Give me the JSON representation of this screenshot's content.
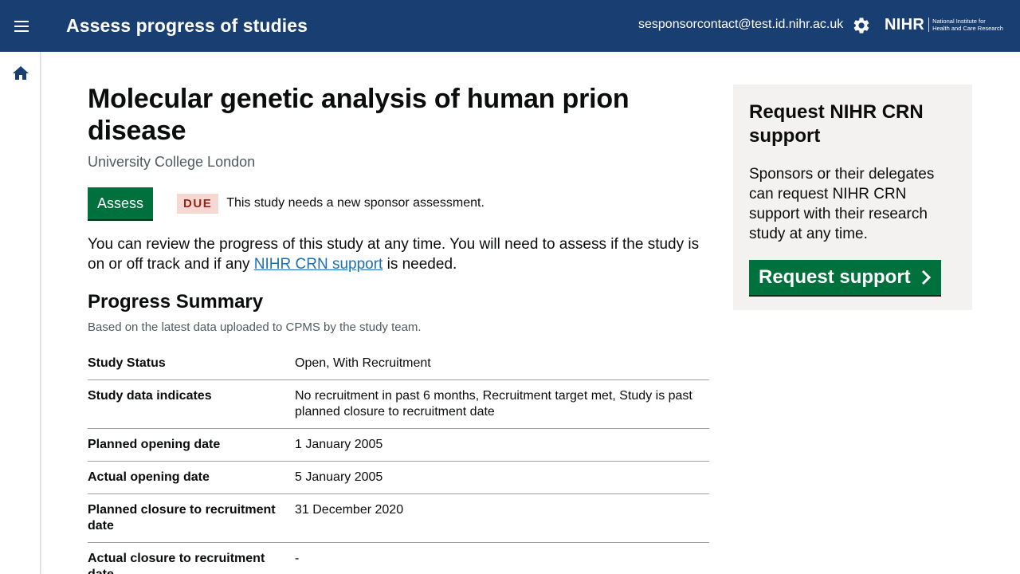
{
  "header": {
    "app_title": "Assess progress of studies",
    "user_email": "sesponsorcontact@test.id.nihr.ac.uk",
    "logo_word": "NIHR",
    "logo_line1": "National Institute for",
    "logo_line2": "Health and Care Research",
    "menu_icon": "hamburger-menu-icon",
    "settings_icon": "gear-icon"
  },
  "sidebar": {
    "home_icon": "home-icon"
  },
  "study": {
    "title": "Molecular genetic analysis of human prion disease",
    "organisation": "University College London",
    "assess_label": "Assess",
    "due_tag": "DUE",
    "due_text": "This study needs a new sponsor assessment.",
    "intro_before": "You can review the progress of this study at any time. You will need to assess if the study is on or off track and if any ",
    "intro_link": "NIHR CRN support",
    "intro_after": " is needed."
  },
  "progress": {
    "heading": "Progress Summary",
    "subheading": "Based on the latest data uploaded to CPMS by the study team.",
    "rows": [
      {
        "key": "Study Status",
        "value": "Open, With Recruitment"
      },
      {
        "key": "Study data indicates",
        "value": "No recruitment in past 6 months, Recruitment target met, Study is past planned closure to recruitment date"
      },
      {
        "key": "Planned opening date",
        "value": "1 January 2005"
      },
      {
        "key": "Actual opening date",
        "value": "5 January 2005"
      },
      {
        "key": "Planned closure to recruitment date",
        "value": "31 December 2020"
      },
      {
        "key": "Actual closure to recruitment date",
        "value": "-"
      }
    ]
  },
  "aside": {
    "title": "Request NIHR CRN support",
    "text": "Sponsors or their delegates can request NIHR CRN support with their research study at any time.",
    "button_label": "Request support"
  },
  "colors": {
    "header_bg": "#193e72",
    "primary_green": "#00703c",
    "link_blue": "#1d70b8",
    "due_bg": "#f6d7d2",
    "due_text": "#942514",
    "aside_bg": "#f3f2f1"
  }
}
